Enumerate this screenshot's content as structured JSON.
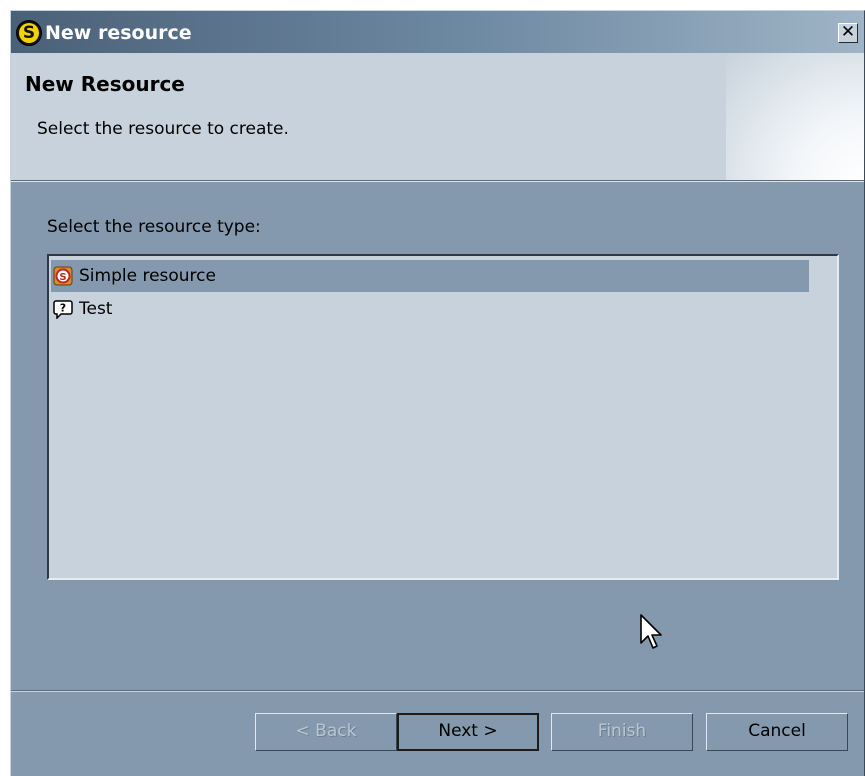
{
  "window": {
    "title": "New resource",
    "app_icon_letter": "S",
    "close_glyph": "✕"
  },
  "banner": {
    "heading": "New Resource",
    "description": "Select the resource to create."
  },
  "resource_list": {
    "label": "Select the resource type:",
    "items": [
      {
        "label": "Simple resource",
        "icon": "simple-resource-icon",
        "selected": true
      },
      {
        "label": "Test",
        "icon": "question-bubble-icon",
        "selected": false
      }
    ]
  },
  "buttons": {
    "back": {
      "label": "< Back",
      "enabled": false
    },
    "next": {
      "label": "Next >",
      "enabled": true,
      "default": true
    },
    "finish": {
      "label": "Finish",
      "enabled": false
    },
    "cancel": {
      "label": "Cancel",
      "enabled": true
    }
  },
  "colors": {
    "dialog_background": "#8499ae",
    "banner_background": "#c8d2dc",
    "selection": "#8499ae"
  }
}
